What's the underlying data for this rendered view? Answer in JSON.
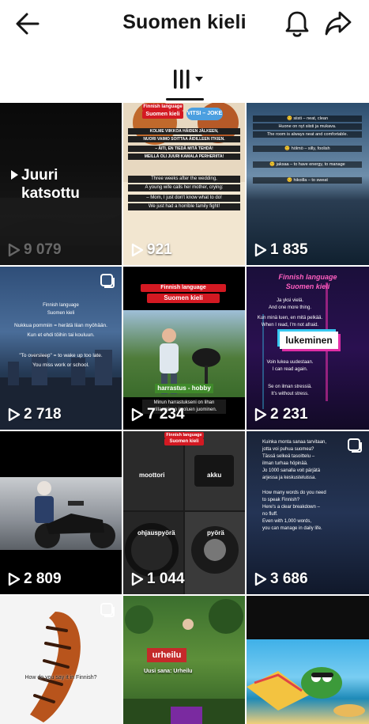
{
  "header": {
    "title": "Suomen kieli",
    "back_icon": "arrow-left-icon",
    "bell_icon": "bell-icon",
    "share_icon": "share-arrow-icon"
  },
  "filter": {
    "icon": "bars-filter-icon",
    "chevron": "caret-down-icon"
  },
  "tiles": [
    {
      "label": "Juuri katsottu",
      "label_line1": "Juuri",
      "label_line2": "katsottu",
      "views": "9 079"
    },
    {
      "views": "921",
      "tag_top": "Finnish language",
      "tag_main": "Suomen kieli",
      "bubble": "VITSI – JOKE",
      "lines": [
        "KOLME VIIKKOA HÄIDEN JÄLKEEN,",
        "NUORI VAIMO SOITTAA ÄIDILLEEN ITKIEN.",
        "– ÄITI, EN TIEDÄ MITÄ TEHDÄ!",
        "MEILLÄ OLI JUURI KAMALA PERHERIITA!",
        "Three weeks after the wedding,",
        "A young wife calls her mother, crying:",
        "– Mom, I just don't know what to do!",
        "We just had a horrible family fight!"
      ]
    },
    {
      "views": "1 835",
      "lines": [
        "😊 siisti – neat, clean",
        "Huone on nyt siisti ja mukava.",
        "The room is always neat and comfortable.",
        "😊 hölmö – silly, foolish",
        "😊 jaksaa – to have energy, to manage",
        "😊 hikoilla – to sweat"
      ]
    },
    {
      "views": "2 718",
      "lines": [
        "Finnish language",
        "Suomen kieli",
        "Nukkua pommiin = herätä liian myöhään.",
        "Kun et ehdi töihin tai kouluun.",
        "\"To oversleep\" = to wake up too late.",
        "You miss work or school."
      ]
    },
    {
      "views": "7 234",
      "tag_top": "Finnish language",
      "tag_main": "Suomen kieli",
      "label": "harrastus - hobby",
      "caption": "Minun harrastukseni on lihan grillaaminen ja oluen juominen."
    },
    {
      "views": "2 231",
      "title": "Finnish language",
      "subtitle": "Suomen kieli",
      "label": "lukeminen",
      "lines": [
        "Ja yksi vielä.",
        "And one more thing.",
        "Kun minä luen, en mitä pelkää.",
        "When I read, I'm not afraid.",
        "Voin lukea uudestaan.",
        "I can read again.",
        "Se on ilman stressiä.",
        "It's without stress."
      ]
    },
    {
      "views": "2 809"
    },
    {
      "views": "1 044",
      "tag_top": "Finnish language",
      "tag_main": "Suomen kieli",
      "labels": [
        "moottori",
        "akku",
        "ohjauspyörä",
        "pyörä"
      ]
    },
    {
      "views": "3 686",
      "lines": [
        "Kuinka monta sanaa tarvitaan,",
        "jotta voi puhua suomea?",
        "Tässä selkeä tasoittelu –",
        "ilman turhaa höpinää.",
        "Jo 1000 sanalla voit pärjätä",
        "arjessa ja keskusteluissa.",
        "How many words do you need",
        "to speak Finnish?",
        "Here's a clear breakdown –",
        "no fluff.",
        "Even with 1,000 words,",
        "you can manage in daily life."
      ]
    },
    {
      "caption": "How do you say it in Finnish?"
    },
    {
      "label": "urheilu",
      "sub": "Uusi sana: Urheilu"
    },
    {}
  ],
  "colors": {
    "accent": "#161616",
    "red_tag": "#d31922"
  }
}
